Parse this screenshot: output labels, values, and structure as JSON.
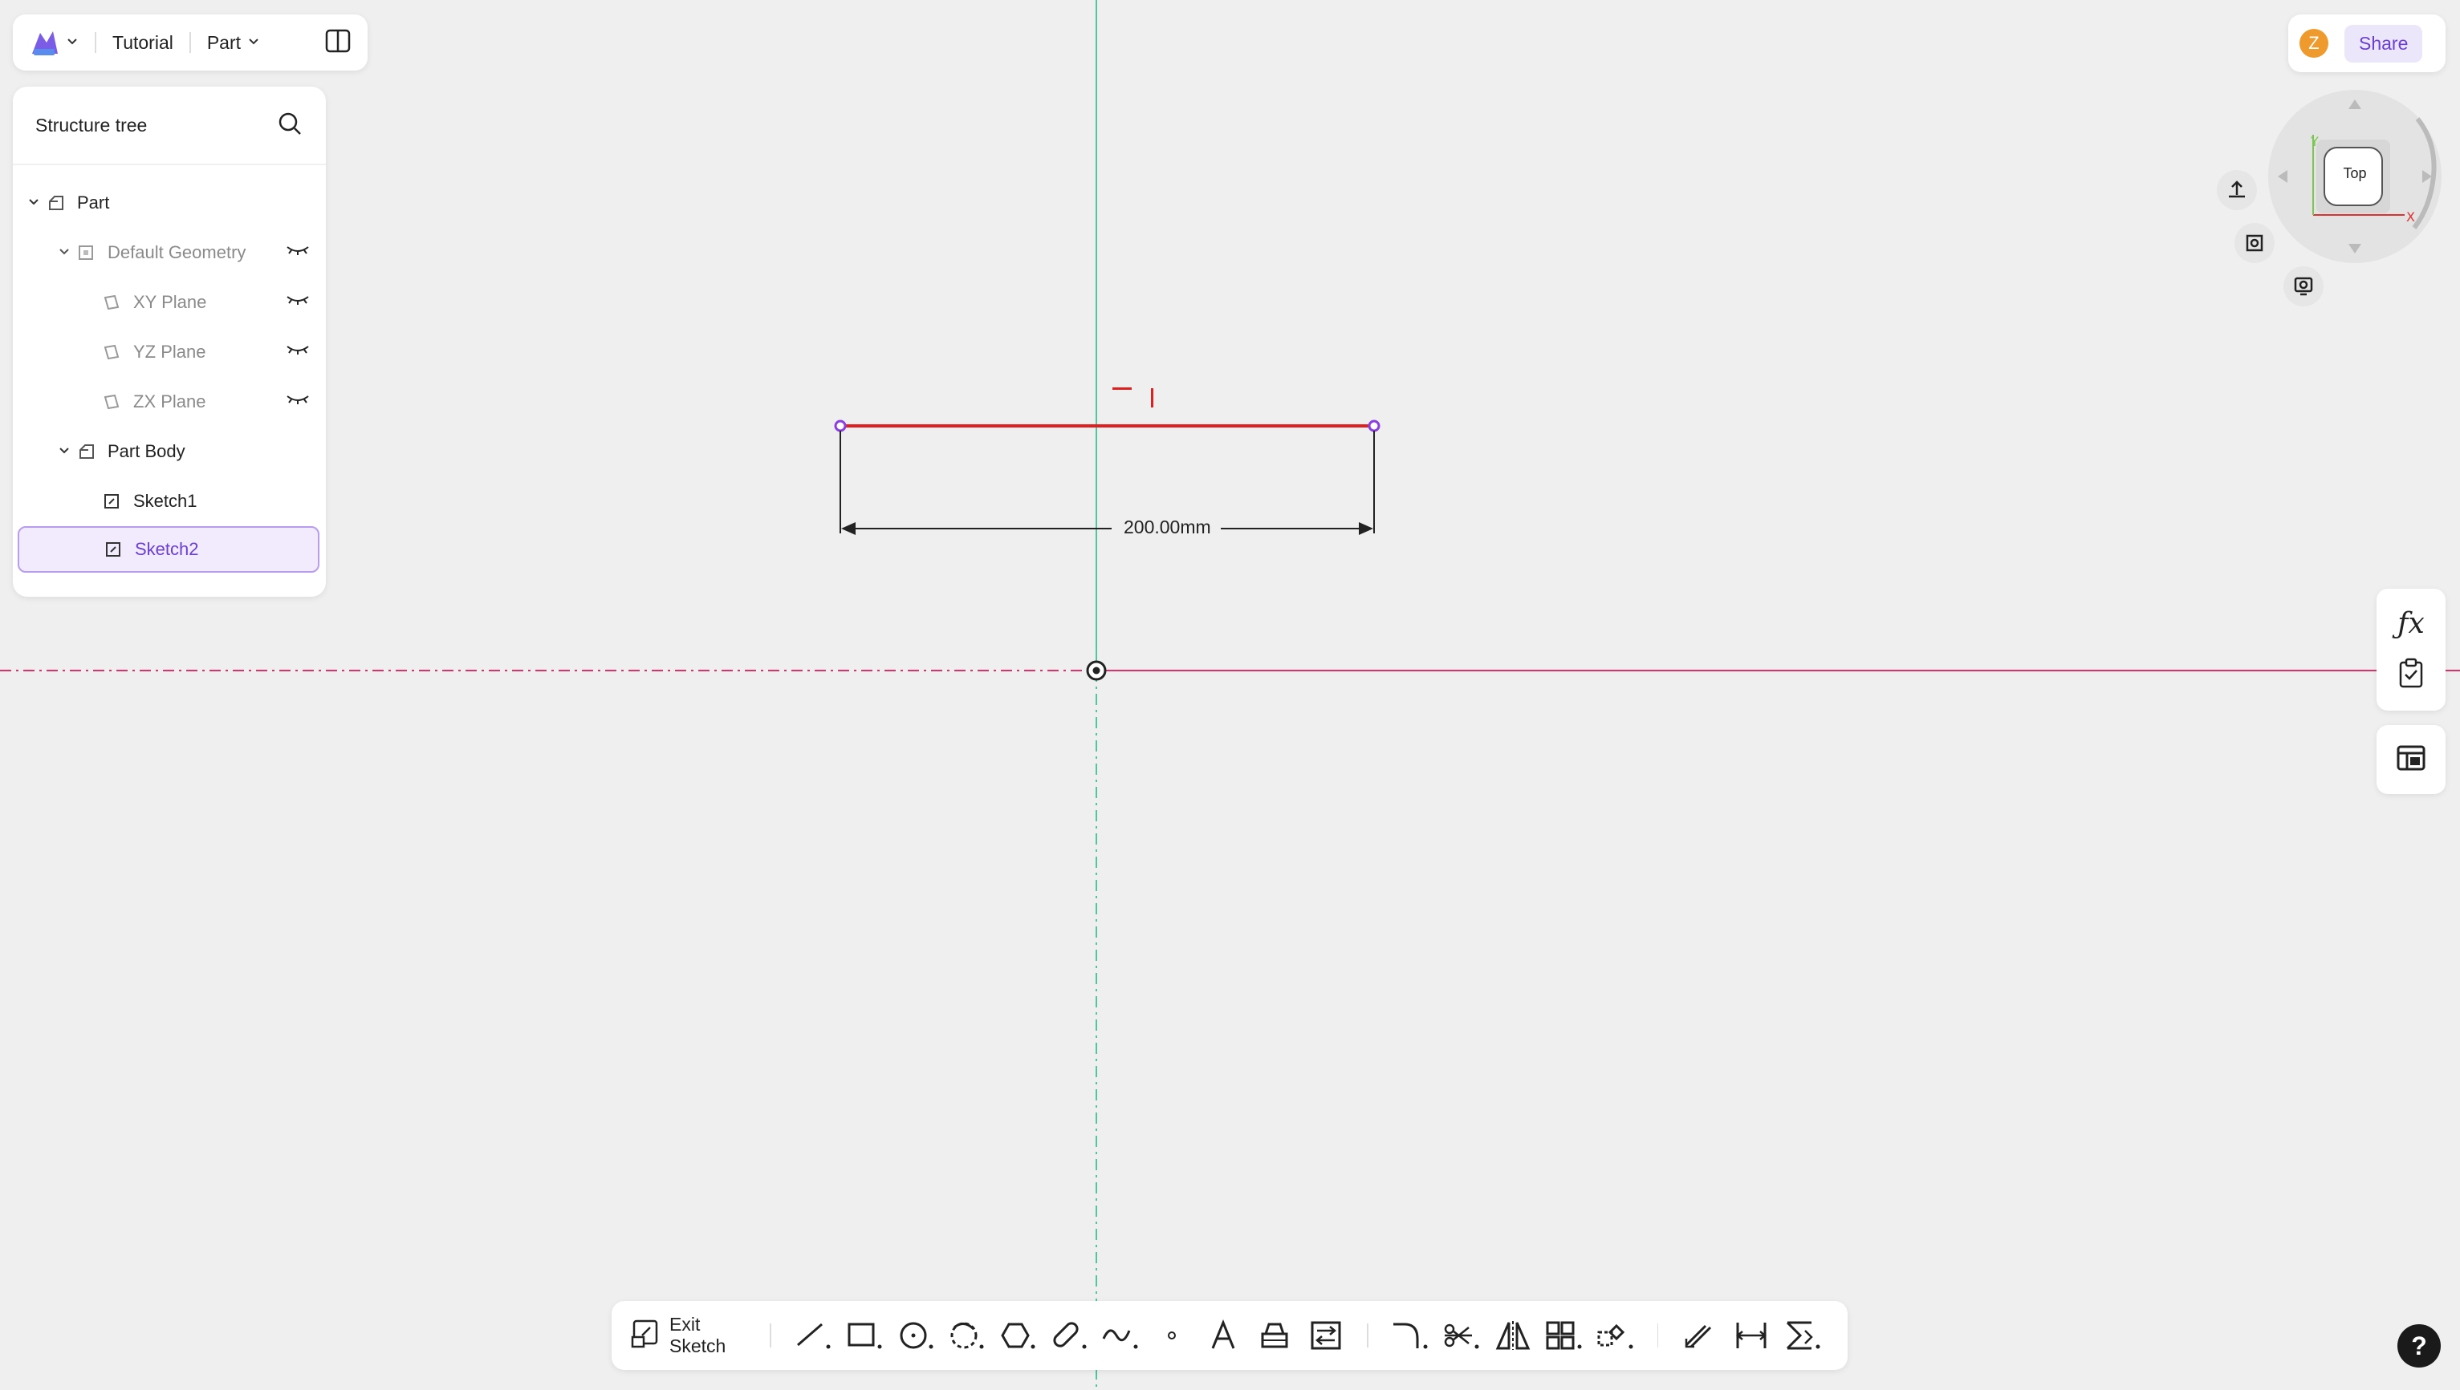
{
  "topbar": {
    "logo_icon": "app-logo-icon",
    "project_name": "Tutorial",
    "doc_type": "Part"
  },
  "tree": {
    "title": "Structure tree",
    "items": [
      {
        "label": "Part",
        "icon": "part-icon",
        "level": 0,
        "expanded": true,
        "dim": false
      },
      {
        "label": "Default Geometry",
        "icon": "geometry-folder-icon",
        "level": 1,
        "expanded": true,
        "dim": true
      },
      {
        "label": "XY Plane",
        "icon": "plane-icon",
        "level": 2,
        "dim": true
      },
      {
        "label": "YZ Plane",
        "icon": "plane-icon",
        "level": 2,
        "dim": true
      },
      {
        "label": "ZX Plane",
        "icon": "plane-icon",
        "level": 2,
        "dim": true
      },
      {
        "label": "Part Body",
        "icon": "body-icon",
        "level": 1,
        "expanded": true,
        "dim": false
      },
      {
        "label": "Sketch1",
        "icon": "sketch-icon",
        "level": 2,
        "dim": false
      },
      {
        "label": "Sketch2",
        "icon": "sketch-icon",
        "level": 2,
        "dim": false,
        "selected": true
      }
    ]
  },
  "share": {
    "avatar_letter": "Z",
    "avatar_color": "#ef9a2d",
    "button_label": "Share"
  },
  "navcube": {
    "face_label": "Top",
    "axis_y": "Y",
    "axis_x": "X"
  },
  "canvas": {
    "dimension_label": "200.00mm",
    "sketch_line_color": "#e02020",
    "vertical_axis_color": "#52c4a0",
    "horizontal_axis_color": "#e0306a"
  },
  "toolbar": {
    "exit_label": "Exit Sketch",
    "tools": [
      "line-tool-icon",
      "rectangle-tool-icon",
      "circle-tool-icon",
      "arc-tool-icon",
      "polygon-tool-icon",
      "slot-tool-icon",
      "spline-tool-icon",
      "point-tool-icon",
      "text-tool-icon",
      "project-tool-icon",
      "convert-tool-icon",
      "fillet-tool-icon",
      "trim-tool-icon",
      "mirror-tool-icon",
      "pattern-tool-icon",
      "transform-tool-icon",
      "offset-tool-icon",
      "dimension-tool-icon",
      "constraint-tool-icon"
    ]
  },
  "help": {
    "label": "?"
  },
  "colors": {
    "accent": "#6b3fd4",
    "selected_bg": "#f2ebfd"
  }
}
